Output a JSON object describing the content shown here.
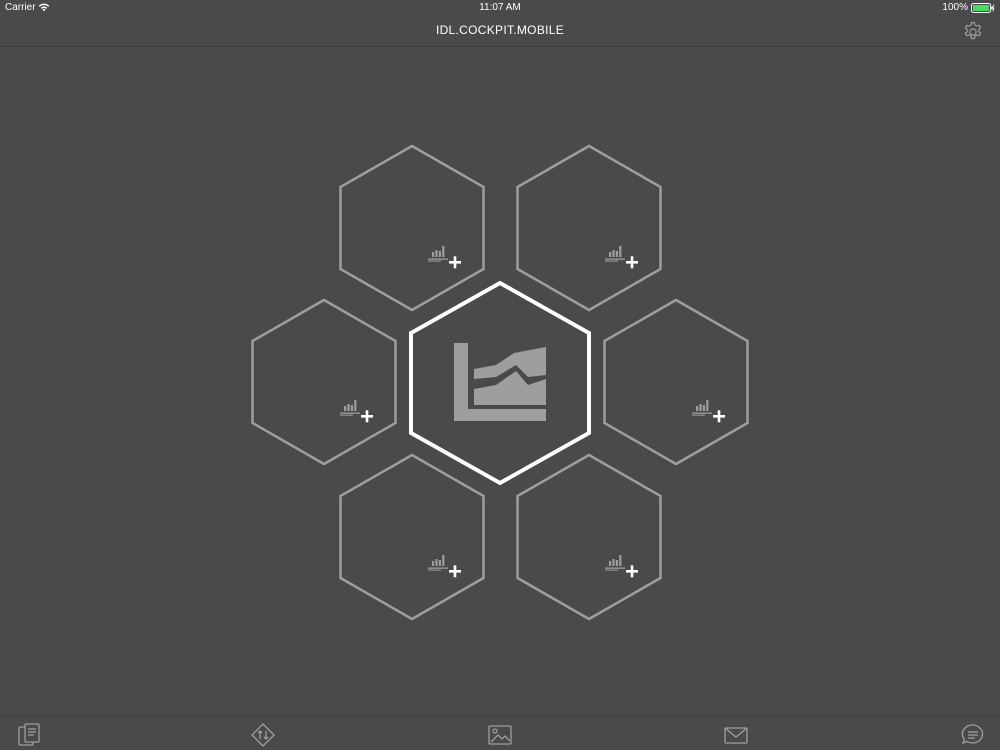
{
  "status_bar": {
    "carrier": "Carrier",
    "time": "11:07 AM",
    "battery": "100%"
  },
  "nav": {
    "title": "IDL.COCKPIT.MOBILE",
    "settings_icon": "gear-icon"
  },
  "colors": {
    "background": "#4a494c",
    "hex_stroke": "#9e9e9e",
    "hex_center_stroke": "#ffffff",
    "icon_gray": "#9e9e9e",
    "battery_green": "#4cd964"
  },
  "hexagons": {
    "center": {
      "icon": "area-chart-icon"
    },
    "slots": [
      {
        "id": "top-left",
        "icon": "add-chart-icon"
      },
      {
        "id": "top-right",
        "icon": "add-chart-icon"
      },
      {
        "id": "middle-left",
        "icon": "add-chart-icon"
      },
      {
        "id": "middle-right",
        "icon": "add-chart-icon"
      },
      {
        "id": "bottom-left",
        "icon": "add-chart-icon"
      },
      {
        "id": "bottom-right",
        "icon": "add-chart-icon"
      }
    ]
  },
  "toolbar": {
    "items": [
      {
        "id": "documents",
        "icon": "documents-icon"
      },
      {
        "id": "sync",
        "icon": "sync-icon"
      },
      {
        "id": "gallery",
        "icon": "image-icon"
      },
      {
        "id": "mail",
        "icon": "mail-icon"
      },
      {
        "id": "chat",
        "icon": "chat-icon"
      }
    ]
  }
}
